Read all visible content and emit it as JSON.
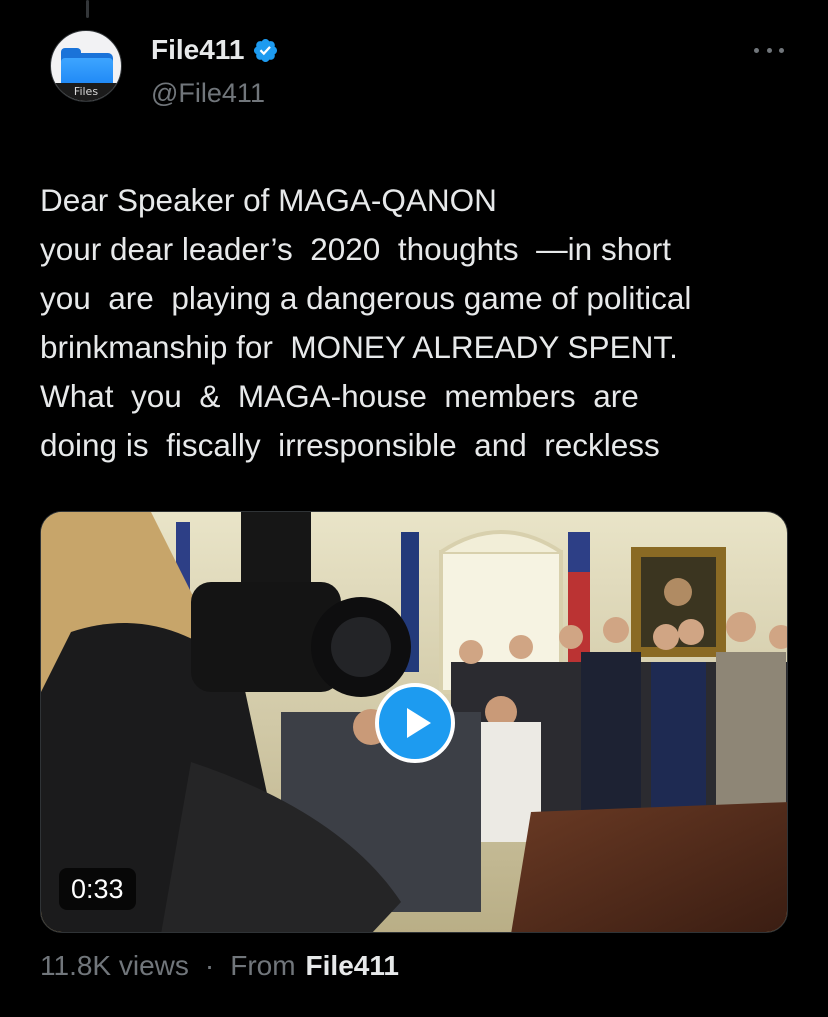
{
  "author": {
    "display_name": "File411",
    "handle": "@File411",
    "avatar_label": "Files",
    "verified": true
  },
  "tweet": {
    "lines": [
      "Dear Speaker of MAGA-QANON",
      "your dear leader’s  2020  thoughts  —in short",
      "you  are  playing a dangerous game of political",
      "brinkmanship for  MONEY ALREADY SPENT.",
      "What  you  &  MAGA-house  members  are",
      "doing is  fiscally  irresponsible  and  reckless"
    ]
  },
  "video": {
    "duration": "0:33"
  },
  "footer": {
    "views": "11.8K views",
    "separator": "·",
    "from_label": "From",
    "source": "File411"
  },
  "colors": {
    "accent": "#1d9bf0",
    "secondary_text": "#71767b",
    "background": "#000000"
  }
}
